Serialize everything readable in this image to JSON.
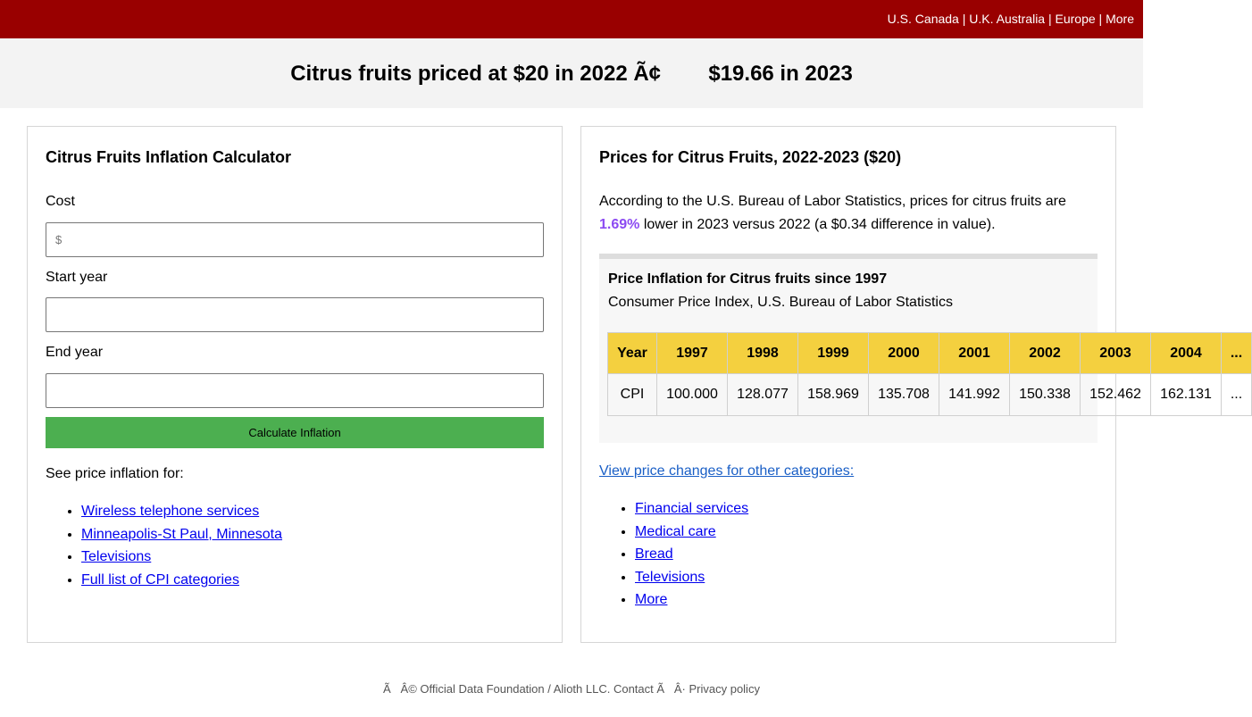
{
  "topbar": {
    "links": [
      "U.S.",
      "Canada",
      "U.K.",
      "Australia",
      "Europe",
      "More"
    ]
  },
  "banner": {
    "title": "Citrus fruits priced at $20 in 2022 Ã¢        $19.66 in 2023"
  },
  "calculator": {
    "heading": "Citrus Fruits Inflation Calculator",
    "cost_label": "Cost",
    "cost_placeholder": "$",
    "cost_value": "",
    "start_label": "Start year",
    "start_value": "",
    "end_label": "End year",
    "end_value": "",
    "button_label": "Calculate Inflation",
    "see_also_label": "See price inflation for:",
    "see_also_links": [
      "Wireless telephone services",
      "Minneapolis-St Paul, Minnesota",
      "Televisions",
      "Full list of CPI categories"
    ]
  },
  "prices": {
    "heading": "Prices for Citrus Fruits, 2022-2023 ($20)",
    "desc_start": "According to the U.S. Bureau of Labor Statistics, prices for citrus fruits are",
    "percent": "1.69%",
    "desc_end": " lower in 2023 versus 2022 (a $0.34 difference in value).",
    "cpi_box": {
      "title": "Price Inflation for Citrus fruits since 1997",
      "subtitle": "Consumer Price Index, U.S. Bureau of Labor Statistics",
      "header_label": "Year",
      "row_label": "CPI",
      "years": [
        "1997",
        "1998",
        "1999",
        "2000",
        "2001",
        "2002",
        "2003",
        "2004",
        "..."
      ],
      "values": [
        "100.000",
        "128.077",
        "158.969",
        "135.708",
        "141.992",
        "150.338",
        "152.462",
        "162.131",
        "..."
      ]
    },
    "other_link": "View price changes for other categories:",
    "categories": [
      "Financial services",
      "Medical care",
      "Bread",
      "Televisions",
      "More"
    ]
  },
  "footer": {
    "text": "Ã   Â© Official Data Foundation / Alioth LLC. Contact Ã   Â· Privacy policy"
  },
  "colors": {
    "topbar": "#990000",
    "banner": "#f3f3f3",
    "button": "#4caf50",
    "percent": "#8c4bf2",
    "table_header": "#f4d03f"
  }
}
